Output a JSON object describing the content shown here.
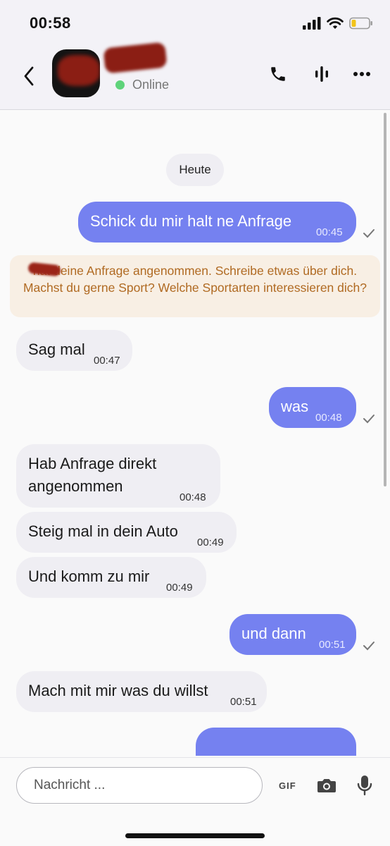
{
  "status_bar": {
    "time": "00:58"
  },
  "header": {
    "status": "Online"
  },
  "chat": {
    "date_chip": "Heute",
    "messages": [
      {
        "dir": "out",
        "text": "Schick du mir halt ne Anfrage",
        "time": "00:45"
      },
      {
        "dir": "in",
        "text": "Sag mal",
        "time": "00:47"
      },
      {
        "dir": "out",
        "text": "was",
        "time": "00:48"
      },
      {
        "dir": "in",
        "text_line1": "Hab Anfrage direkt",
        "text_line2": "angenommen",
        "time": "00:48"
      },
      {
        "dir": "in",
        "text": "Steig mal in dein Auto",
        "time": "00:49"
      },
      {
        "dir": "in",
        "text": "Und komm zu mir",
        "time": "00:49"
      },
      {
        "dir": "out",
        "text": "und dann",
        "time": "00:51"
      },
      {
        "dir": "in",
        "text": "Mach mit mir was du willst",
        "time": "00:51"
      }
    ],
    "system_notice": "hat deine Anfrage angenommen. Schreibe etwas über dich. Machst du gerne Sport? Welche Sportarten interessieren dich?"
  },
  "composer": {
    "placeholder": "Nachricht ...",
    "gif_label": "GIF"
  },
  "colors": {
    "outgoing_bubble": "#7581f0",
    "incoming_bubble": "#efeef3",
    "system_text": "#b06a22",
    "system_bg": "#f8efe4",
    "online": "#5fd37a"
  },
  "icons": [
    "signal-icon",
    "wifi-icon",
    "battery-icon",
    "back-arrow-icon",
    "phone-icon",
    "voice-icon",
    "more-icon",
    "check-icon",
    "camera-icon",
    "microphone-icon"
  ]
}
